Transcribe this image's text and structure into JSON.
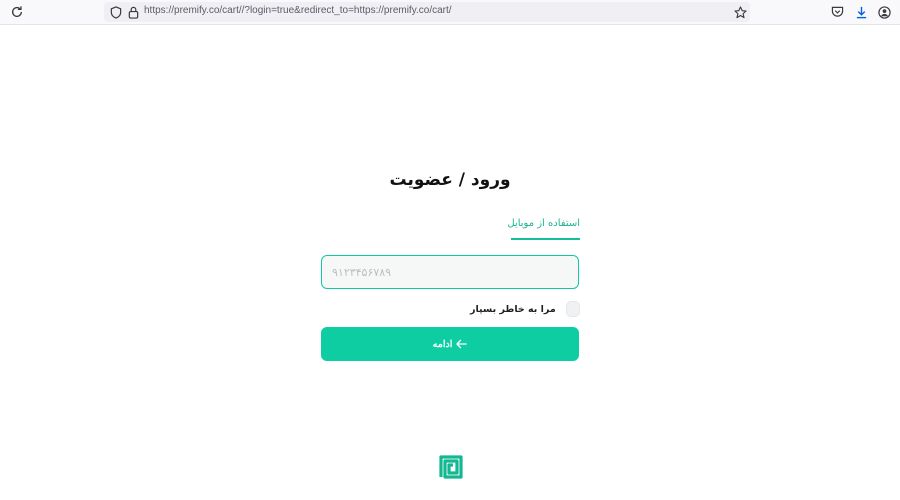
{
  "browser": {
    "url": "https://premify.co/cart//?login=true&redirect_to=https://premify.co/cart/",
    "icons": {
      "reload": "reload-icon",
      "shield": "shield-icon",
      "lock": "lock-icon",
      "bookmark": "star-icon",
      "pocket": "pocket-icon",
      "downloads": "download-icon",
      "account": "account-icon"
    }
  },
  "login": {
    "title": "ورود / عضویت",
    "tab_mobile": "استفاده از موبایل",
    "phone_placeholder": "۹۱۲۳۴۵۶۷۸۹",
    "phone_value": "",
    "remember_label": "مرا به خاطر بسپار",
    "remember_checked": false,
    "continue_label": "ادامه"
  },
  "colors": {
    "accent": "#0ecda3",
    "logo": "#13b892"
  }
}
